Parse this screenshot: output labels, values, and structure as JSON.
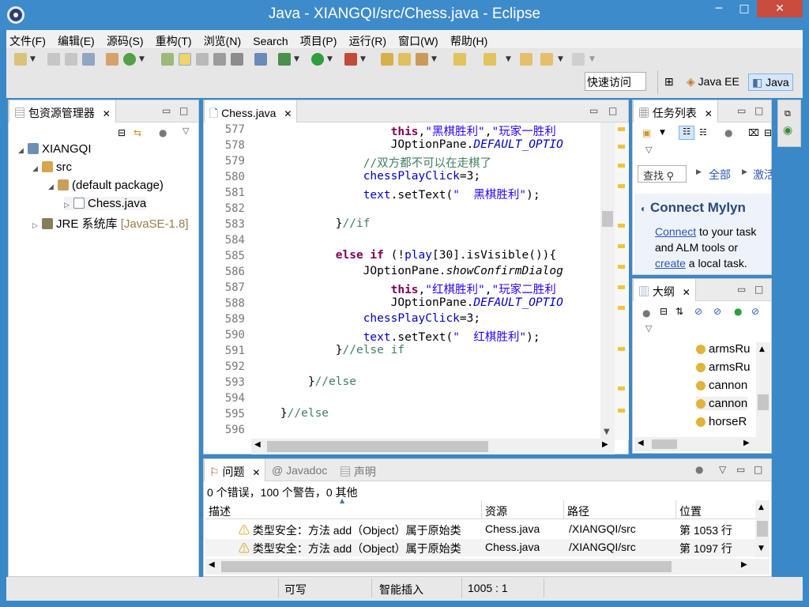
{
  "window": {
    "title": "Java - XIANGQI/src/Chess.java - Eclipse",
    "minimize": "─",
    "maximize": "□",
    "close": "✕"
  },
  "menu": [
    "文件(F)",
    "编辑(E)",
    "源码(S)",
    "重构(T)",
    "浏览(N)",
    "Search",
    "项目(P)",
    "运行(R)",
    "窗口(W)",
    "帮助(H)"
  ],
  "toolbar": {
    "quick_access": "快速访问",
    "perspectives": [
      "Java EE",
      "Java"
    ]
  },
  "explorer": {
    "tab": "包资源管理器",
    "tree": [
      {
        "label": "XIANGQI",
        "level": 0
      },
      {
        "label": "src",
        "level": 1
      },
      {
        "label": "(default package)",
        "level": 2
      },
      {
        "label": "Chess.java",
        "level": 3
      },
      {
        "label": "JRE 系统库",
        "extra": "[JavaSE-1.8]",
        "level": 0
      }
    ]
  },
  "editor": {
    "tab": "Chess.java",
    "lines": [
      {
        "n": "577",
        "segs": [
          [
            "",
            "                    "
          ],
          [
            "kw",
            "this"
          ],
          [
            "",
            ","
          ],
          [
            "str",
            "\"黑棋胜利\""
          ],
          [
            "",
            ","
          ],
          [
            "str",
            "\"玩家一胜利"
          ]
        ]
      },
      {
        "n": "578",
        "segs": [
          [
            "",
            "                    JOptionPane."
          ],
          [
            "fld it",
            "DEFAULT_OPTIO"
          ]
        ]
      },
      {
        "n": "579",
        "segs": [
          [
            "",
            "                "
          ],
          [
            "cmt",
            "//双方都不可以在走棋了"
          ]
        ]
      },
      {
        "n": "580",
        "segs": [
          [
            "",
            "                "
          ],
          [
            "fld",
            "chessPlayClick"
          ],
          [
            "",
            "=3;"
          ]
        ]
      },
      {
        "n": "581",
        "segs": [
          [
            "",
            "                "
          ],
          [
            "fld",
            "text"
          ],
          [
            "",
            ".setText("
          ],
          [
            "str",
            "\"  黑棋胜利\""
          ],
          [
            "",
            ");"
          ]
        ]
      },
      {
        "n": "582",
        "segs": [
          [
            "",
            ""
          ]
        ]
      },
      {
        "n": "583",
        "segs": [
          [
            "",
            "            }"
          ],
          [
            "cmt",
            "//if"
          ]
        ]
      },
      {
        "n": "584",
        "segs": [
          [
            "",
            ""
          ]
        ]
      },
      {
        "n": "585",
        "segs": [
          [
            "",
            "            "
          ],
          [
            "kw",
            "else if"
          ],
          [
            "",
            " (!"
          ],
          [
            "fld",
            "play"
          ],
          [
            "",
            "[30].isVisible()){"
          ]
        ]
      },
      {
        "n": "586",
        "segs": [
          [
            "",
            "                JOptionPane."
          ],
          [
            "it",
            "showConfirmDialog"
          ]
        ]
      },
      {
        "n": "587",
        "segs": [
          [
            "",
            "                    "
          ],
          [
            "kw",
            "this"
          ],
          [
            "",
            ","
          ],
          [
            "str",
            "\"红棋胜利\""
          ],
          [
            "",
            ","
          ],
          [
            "str",
            "\"玩家二胜利"
          ]
        ]
      },
      {
        "n": "588",
        "segs": [
          [
            "",
            "                    JOptionPane."
          ],
          [
            "fld it",
            "DEFAULT_OPTIO"
          ]
        ]
      },
      {
        "n": "589",
        "segs": [
          [
            "",
            "                "
          ],
          [
            "fld",
            "chessPlayClick"
          ],
          [
            "",
            "=3;"
          ]
        ]
      },
      {
        "n": "590",
        "segs": [
          [
            "",
            "                "
          ],
          [
            "fld",
            "text"
          ],
          [
            "",
            ".setText("
          ],
          [
            "str",
            "\"  红棋胜利\""
          ],
          [
            "",
            ");"
          ]
        ]
      },
      {
        "n": "591",
        "segs": [
          [
            "",
            "            }"
          ],
          [
            "cmt",
            "//else if"
          ]
        ]
      },
      {
        "n": "592",
        "segs": [
          [
            "",
            ""
          ]
        ]
      },
      {
        "n": "593",
        "segs": [
          [
            "",
            "        }"
          ],
          [
            "cmt",
            "//else"
          ]
        ]
      },
      {
        "n": "594",
        "segs": [
          [
            "",
            ""
          ]
        ]
      },
      {
        "n": "595",
        "segs": [
          [
            "",
            "    }"
          ],
          [
            "cmt",
            "//else"
          ]
        ]
      },
      {
        "n": "596",
        "segs": [
          [
            "",
            ""
          ]
        ]
      }
    ]
  },
  "tasklist": {
    "tab": "任务列表",
    "find_placeholder": "查找",
    "all": "全部",
    "activate": "激活...",
    "mylyn_title": "Connect Mylyn",
    "mylyn_connect": "Connect",
    "mylyn_text1": " to your task",
    "mylyn_text2": "and ALM tools or",
    "mylyn_create": "create",
    "mylyn_text3": " a local task."
  },
  "outline": {
    "tab": "大纲",
    "items": [
      "armsRu",
      "armsRu",
      "cannon",
      "cannon",
      "horseR"
    ]
  },
  "problems": {
    "tabs": [
      "问题",
      "Javadoc",
      "声明"
    ],
    "summary": "0 个错误，100 个警告，0 其他",
    "columns": [
      "描述",
      "资源",
      "路径",
      "位置"
    ],
    "rows": [
      {
        "desc": "类型安全：方法 add（Object）属于原始类",
        "resource": "Chess.java",
        "path": "/XIANGQI/src",
        "loc": "第 1053 行"
      },
      {
        "desc": "类型安全：方法 add（Object）属于原始类",
        "resource": "Chess.java",
        "path": "/XIANGQI/src",
        "loc": "第 1097 行"
      }
    ]
  },
  "status": {
    "writable": "可写",
    "insert_mode": "智能插入",
    "position": "1005 : 1"
  }
}
